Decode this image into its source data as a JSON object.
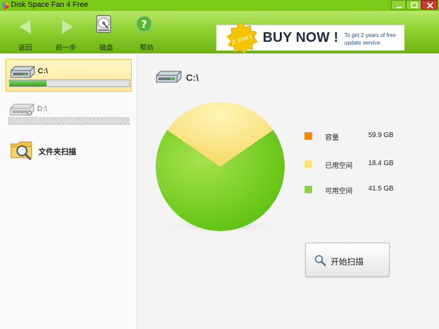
{
  "window": {
    "title": "Disk Space Fan 4 Free"
  },
  "toolbar": {
    "back_label": "返回",
    "forward_label": "前一步",
    "disk_label": "磁盘",
    "help_label": "帮助"
  },
  "banner": {
    "badge_text": "2 Years",
    "buy_now": "BUY NOW !",
    "promo_text": "To get 2 years of free update service."
  },
  "sidebar": {
    "drives": [
      {
        "name": "C:\\",
        "usage_percent": 31,
        "active": true
      },
      {
        "name": "D:\\",
        "usage_percent": null,
        "active": false
      }
    ],
    "folder_scan_label": "文件夹扫描"
  },
  "main": {
    "drive_label": "C:\\",
    "legend": [
      {
        "label": "容量",
        "value": "59.9 GB",
        "color": "#f08a00"
      },
      {
        "label": "已用空间",
        "value": "18.4 GB",
        "color": "#fde47a"
      },
      {
        "label": "可用空间",
        "value": "41.5 GB",
        "color": "#8fd04a"
      }
    ],
    "scan_button_label": "开始扫描"
  },
  "colors": {
    "accent_green": "#7cc91a",
    "pie_used": "#fde47a",
    "pie_free": "#6fcc1a",
    "capacity": "#f08a00"
  },
  "chart_data": {
    "type": "pie",
    "categories": [
      "已用空间",
      "可用空间"
    ],
    "values": [
      18.4,
      41.5
    ],
    "title": "",
    "unit": "GB"
  }
}
